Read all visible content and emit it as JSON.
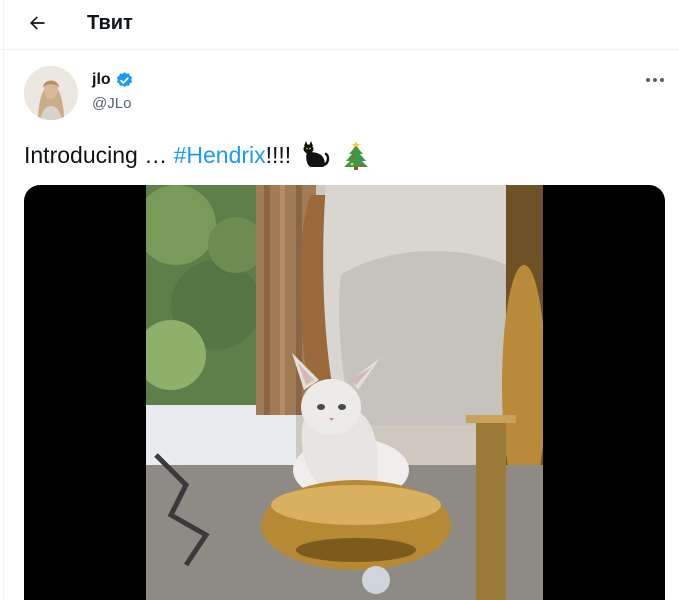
{
  "header": {
    "title": "Твит",
    "back_icon": "arrow-left-icon"
  },
  "tweet": {
    "author": {
      "display_name": "jlo",
      "handle": "@JLo",
      "verified": true,
      "avatar_icon": "avatar-photo"
    },
    "text": {
      "prefix": "Introducing … ",
      "hashtag": "#Hendrix",
      "suffix": "!!!!",
      "emojis": [
        "black-cat-icon",
        "christmas-tree-icon"
      ]
    },
    "more_icon": "more-dots-icon",
    "media": {
      "type": "video",
      "description_icon": "video-frame"
    }
  },
  "colors": {
    "accent": "#1d9bf0",
    "text": "#0f1419",
    "muted": "#536471",
    "divider": "#eff3f4"
  }
}
